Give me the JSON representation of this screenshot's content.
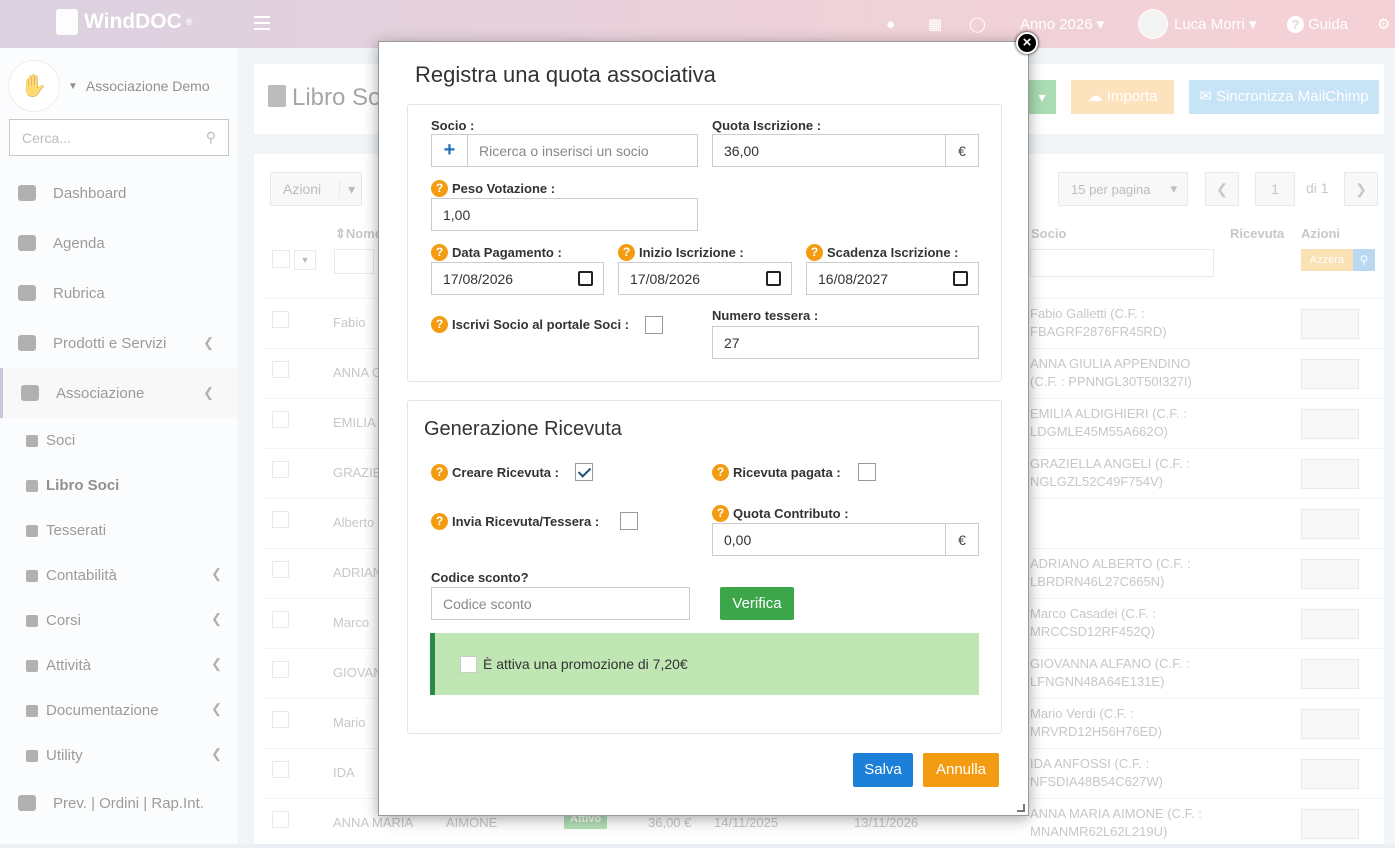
{
  "topbar": {
    "logo": "WindDOC",
    "logo_mark": "®",
    "year": "Anno 2026",
    "user": "Luca Morri",
    "help": "Guida"
  },
  "sidebar": {
    "org": "Associazione Demo",
    "search_placeholder": "Cerca...",
    "items": [
      {
        "label": "Dashboard"
      },
      {
        "label": "Agenda"
      },
      {
        "label": "Rubrica"
      },
      {
        "label": "Prodotti e Servizi"
      },
      {
        "label": "Associazione"
      }
    ],
    "subitems": [
      {
        "label": "Soci"
      },
      {
        "label": "Libro Soci"
      },
      {
        "label": "Tesserati"
      },
      {
        "label": "Contabilità"
      },
      {
        "label": "Corsi"
      },
      {
        "label": "Attività"
      },
      {
        "label": "Documentazione"
      },
      {
        "label": "Utility"
      }
    ],
    "bottom": "Prev. | Ordini | Rap.Int."
  },
  "page": {
    "title": "Libro Soci",
    "import_label": "Importa",
    "mailchimp_label": "Sincronizza MailChimp",
    "azioni_label": "Azioni",
    "per_page": "15 per pagina",
    "page_num": "1",
    "page_of": "di 1",
    "col_nome": "Nome",
    "col_socio": "Socio",
    "col_ricevuta": "Ricevuta",
    "col_azioni": "Azioni",
    "reset_label": "Azzera",
    "rows": [
      {
        "name": "Fabio",
        "socio": "Fabio Galletti (C.F. : FBAGRF2876FR45RD)"
      },
      {
        "name": "ANNA G",
        "socio": "ANNA GIULIA APPENDINO (C.F. : PPNNGL30T50I327I)"
      },
      {
        "name": "EMILIA",
        "socio": "EMILIA ALDIGHIERI (C.F. : LDGMLE45M55A662O)"
      },
      {
        "name": "GRAZIE",
        "socio": "GRAZIELLA ANGELI (C.F. : NGLGZL52C49F754V)"
      },
      {
        "name": "Alberto",
        "socio": ""
      },
      {
        "name": "ADRIAN",
        "socio": "ADRIANO ALBERTO (C.F. : LBRDRN46L27C665N)"
      },
      {
        "name": "Marco",
        "socio": "Marco Casadei (C.F. : MRCCSD12RF452Q)"
      },
      {
        "name": "GIOVAN",
        "socio": "GIOVANNA ALFANO (C.F. : LFNGNN48A64E131E)"
      },
      {
        "name": "Mario",
        "socio": "Mario Verdi (C.F. : MRVRD12H56H76ED)"
      },
      {
        "name": "IDA",
        "socio": "IDA ANFOSSI (C.F. : NFSDIA48B54C627W)"
      },
      {
        "name": "ANNA MARIA",
        "socio": "ANNA MARIA AIMONE (C.F. : MNANMR62L62L219U)"
      }
    ],
    "last_row": {
      "surname": "AIMONE",
      "status": "Attivo",
      "amount": "36,00 €",
      "start": "14/11/2025",
      "end": "13/11/2026"
    }
  },
  "modal": {
    "title": "Registra una quota associativa",
    "socio_label": "Socio :",
    "socio_placeholder": "Ricerca o inserisci un socio",
    "quota_label": "Quota Iscrizione :",
    "quota_value": "36,00",
    "currency": "€",
    "peso_label": "Peso Votazione :",
    "peso_value": "1,00",
    "data_pag_label": "Data Pagamento :",
    "data_pag_value": "17/08/2026",
    "inizio_label": "Inizio Iscrizione :",
    "inizio_value": "17/08/2026",
    "scadenza_label": "Scadenza Iscrizione :",
    "scadenza_value": "16/08/2027",
    "portale_label": "Iscrivi Socio al portale Soci :",
    "tessera_label": "Numero tessera :",
    "tessera_value": "27",
    "ricevuta_title": "Generazione Ricevuta",
    "creare_label": "Creare Ricevuta :",
    "pagata_label": "Ricevuta pagata :",
    "invia_label": "Invia Ricevuta/Tessera :",
    "contributo_label": "Quota Contributo :",
    "contributo_value": "0,00",
    "sconto_label": "Codice sconto?",
    "sconto_placeholder": "Codice sconto",
    "verifica_label": "Verifica",
    "promo_text": "È attiva una promozione di 7,20€",
    "salva_label": "Salva",
    "annulla_label": "Annulla",
    "close_glyph": "×",
    "help_glyph": "?",
    "plus_glyph": "+"
  }
}
